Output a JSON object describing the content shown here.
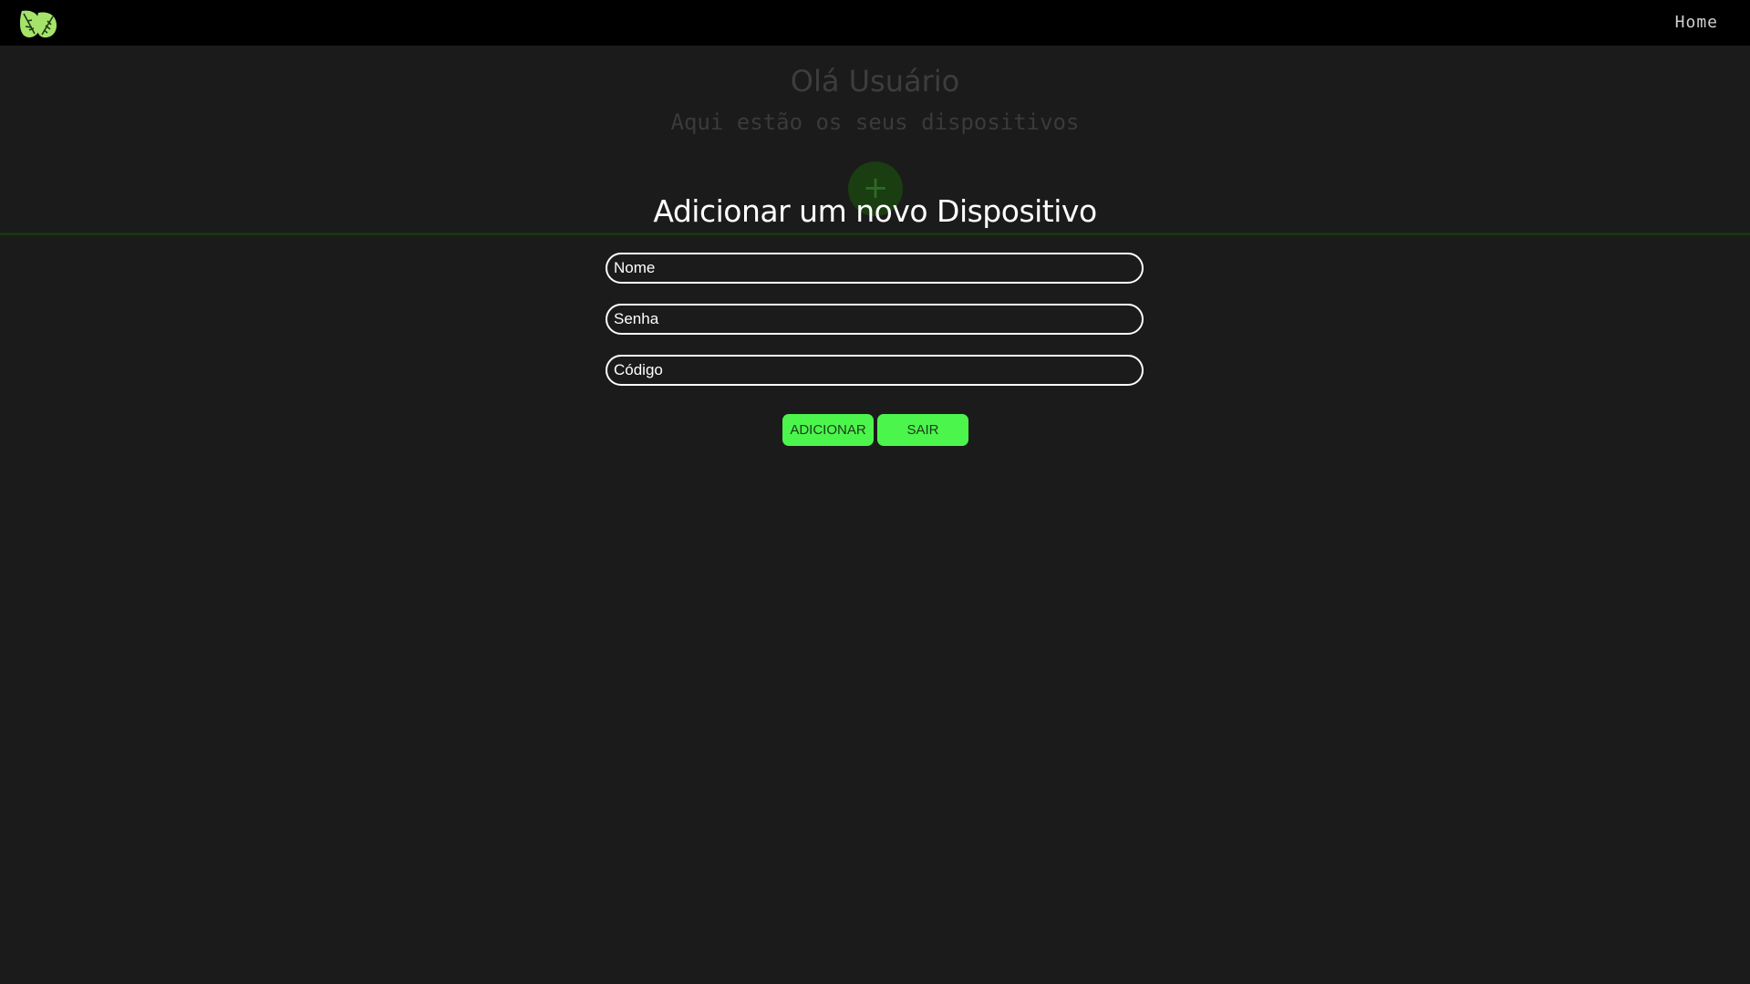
{
  "navbar": {
    "logo_icon": "leaf-logo-icon",
    "home_label": "Home"
  },
  "background_page": {
    "greeting": "Olá Usuário",
    "subtitle": "Aqui estão os seus dispositivos",
    "add_button_glyph": "+"
  },
  "modal": {
    "title": "Adicionar um novo Dispositivo",
    "fields": {
      "nome_placeholder": "Nome",
      "senha_placeholder": "Senha",
      "codigo_placeholder": "Código"
    },
    "buttons": {
      "add_label": "ADICIONAR",
      "exit_label": "SAIR"
    }
  },
  "colors": {
    "navbar_bg": "#000000",
    "page_bg": "#1b1b1b",
    "accent_green": "#4cf54c",
    "logo_green": "#a6e36b"
  }
}
